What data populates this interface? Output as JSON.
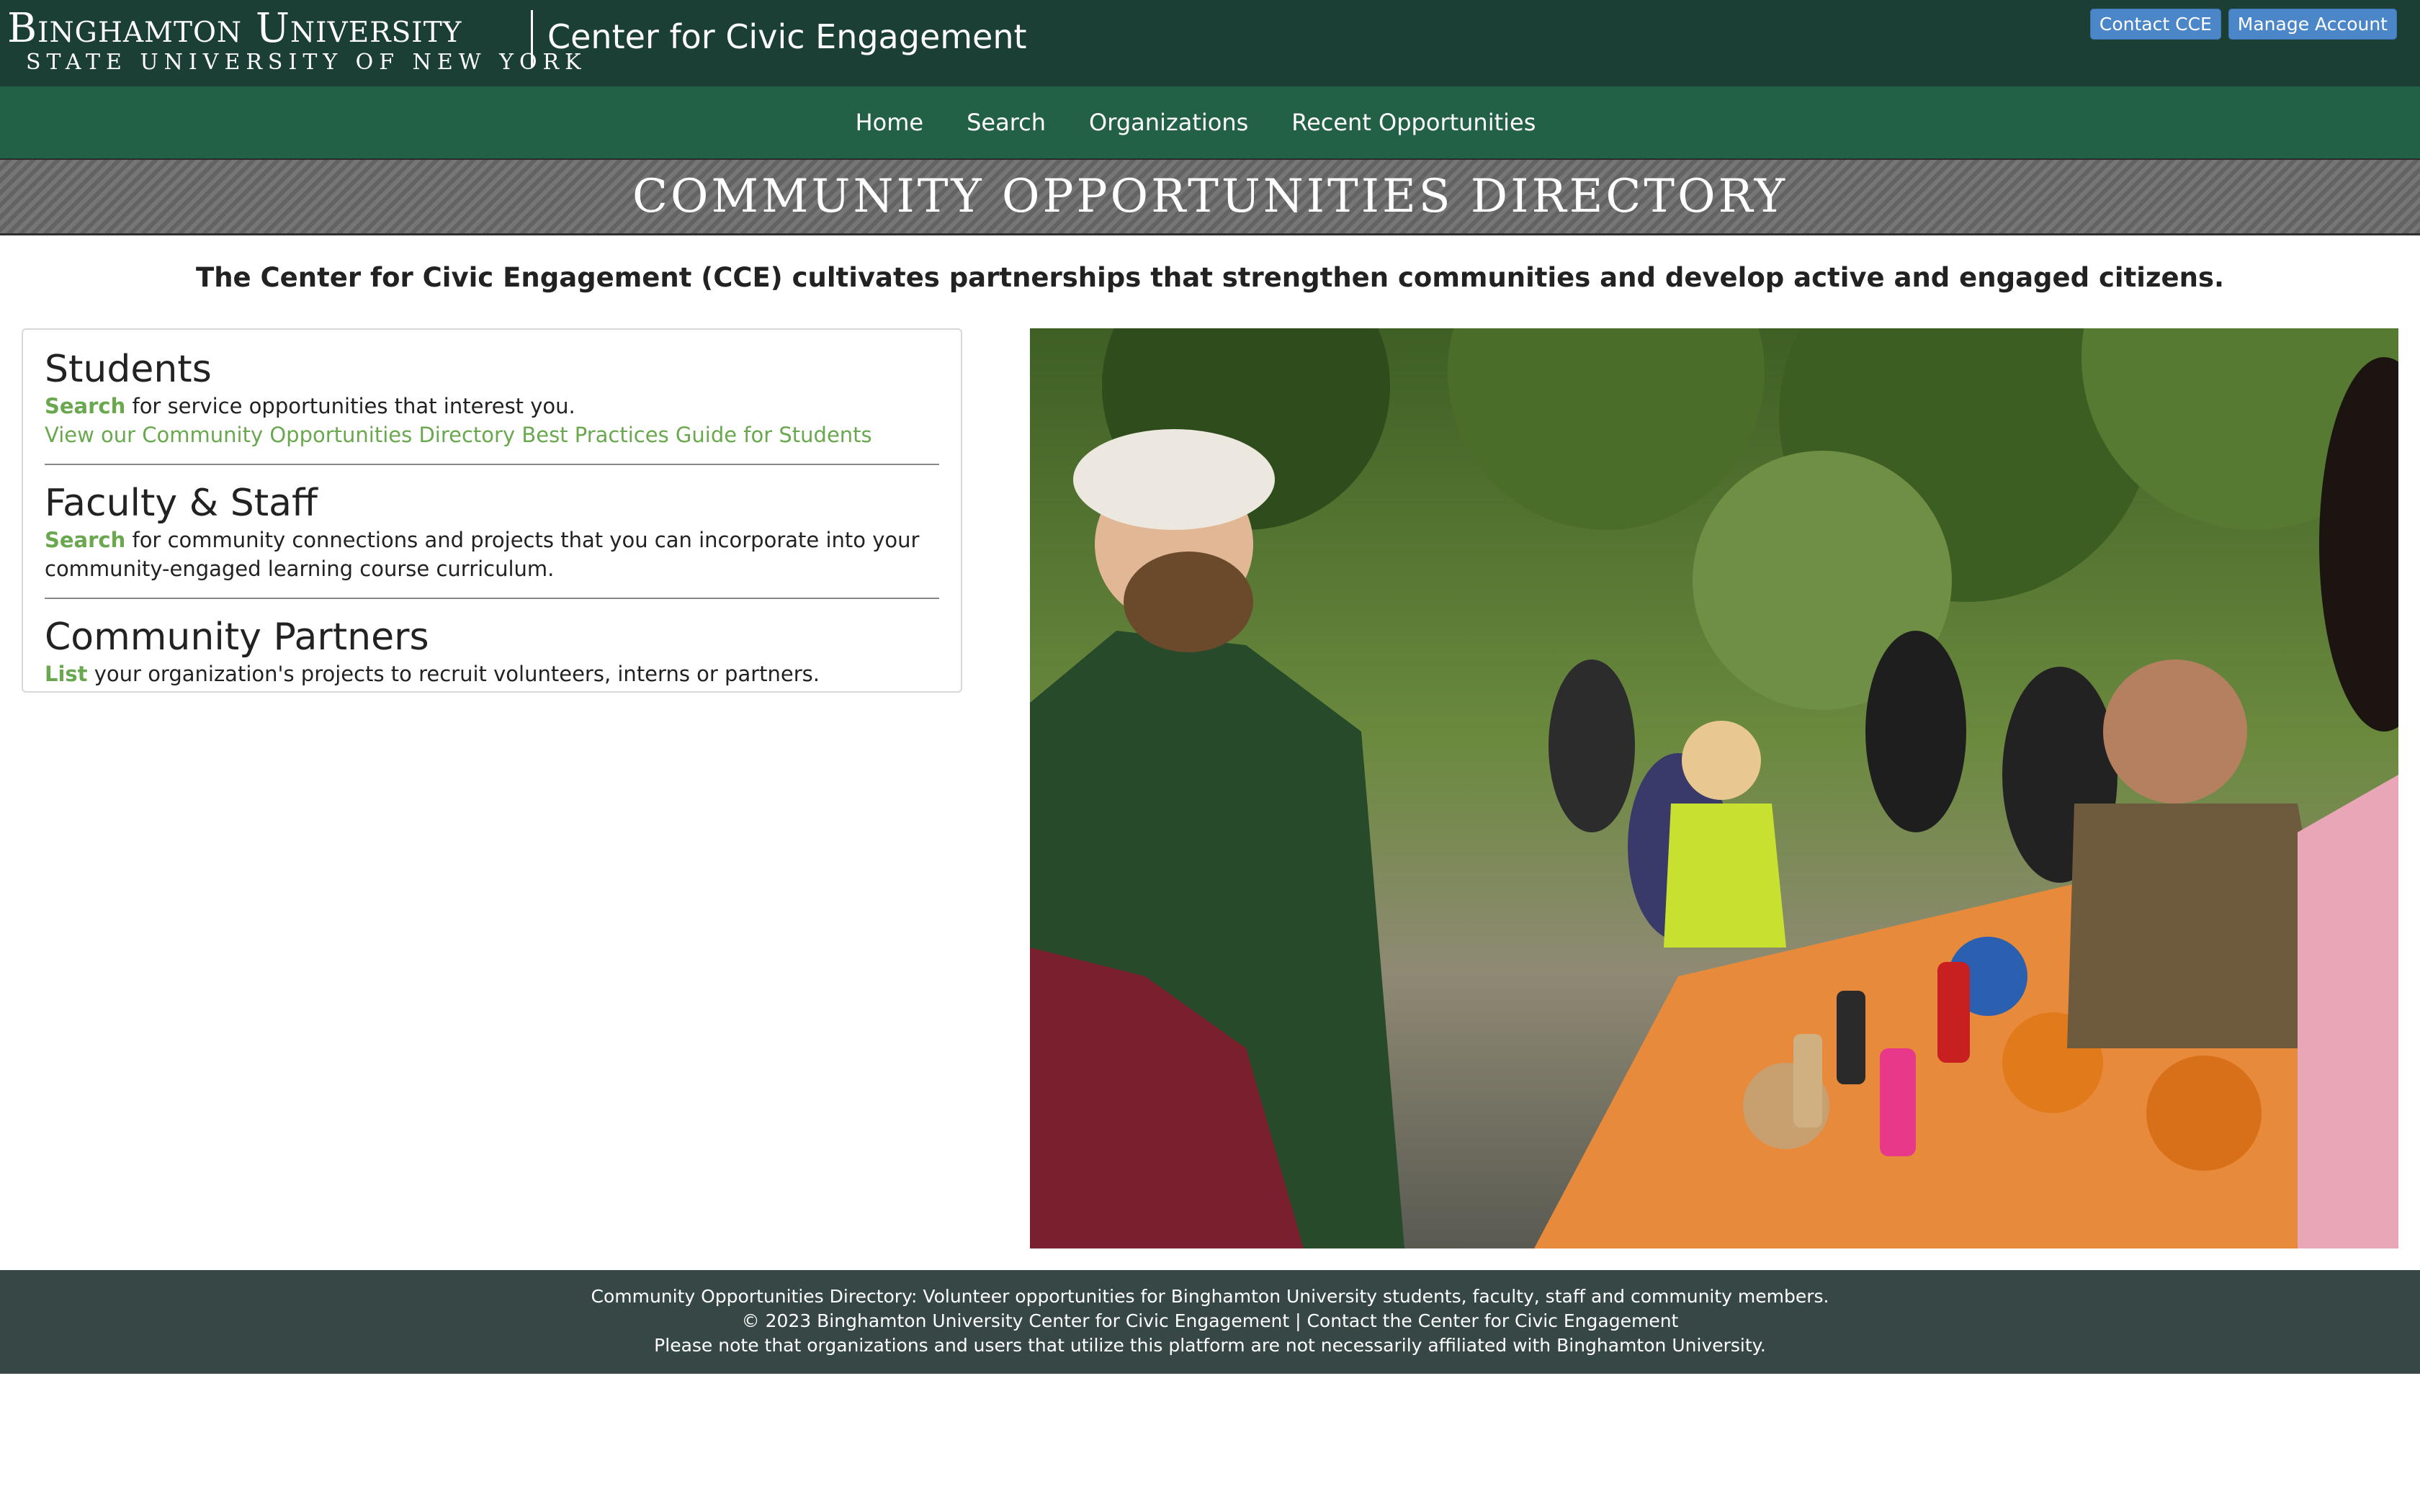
{
  "header": {
    "university_name": "Binghamton University",
    "university_sub": "STATE UNIVERSITY OF NEW YORK",
    "site_title": "Center for Civic Engagement",
    "buttons": {
      "contact": "Contact CCE",
      "manage": "Manage Account"
    }
  },
  "nav": {
    "items": [
      "Home",
      "Search",
      "Organizations",
      "Recent Opportunities"
    ]
  },
  "banner": {
    "title": "COMMUNITY OPPORTUNITIES DIRECTORY"
  },
  "tagline": "The Center for Civic Engagement (CCE) cultivates partnerships that strengthen communities and develop active and engaged citizens.",
  "sections": {
    "students": {
      "heading": "Students",
      "link": "Search",
      "text": " for service opportunities that interest you.",
      "guide_link": "View our Community Opportunities Directory Best Practices Guide for Students"
    },
    "faculty": {
      "heading": "Faculty & Staff",
      "link": "Search",
      "text": " for community connections and projects that you can incorporate into your community-engaged learning course curriculum."
    },
    "partners": {
      "heading": "Community Partners",
      "link": "List",
      "text": " your organization's projects to recruit volunteers, interns or partners."
    }
  },
  "footer": {
    "line1": "Community Opportunities Directory: Volunteer opportunities for Binghamton University students, faculty, staff and community members.",
    "line2": "© 2023 Binghamton University Center for Civic Engagement | Contact the Center for Civic Engagement",
    "line3": "Please note that organizations and users that utilize this platform are not necessarily affiliated with Binghamton University."
  },
  "colors": {
    "topbar": "#1c3f35",
    "navbar": "#236146",
    "link_green": "#6aa84f",
    "button_blue": "#4a86c8",
    "footer": "#364745"
  }
}
